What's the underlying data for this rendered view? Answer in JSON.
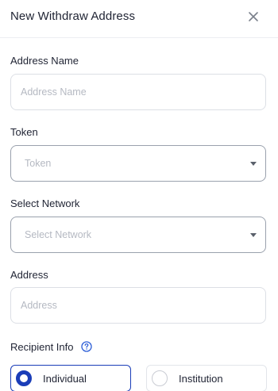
{
  "header": {
    "title": "New Withdraw Address",
    "close_icon": "close-icon"
  },
  "form": {
    "address_name": {
      "label": "Address Name",
      "placeholder": "Address Name",
      "value": ""
    },
    "token": {
      "label": "Token",
      "placeholder": "Token",
      "selected": ""
    },
    "network": {
      "label": "Select Network",
      "placeholder": "Select Network",
      "selected": ""
    },
    "address": {
      "label": "Address",
      "placeholder": "Address",
      "value": ""
    },
    "recipient_info": {
      "label": "Recipient Info",
      "help_icon": "help-circle-icon",
      "options": [
        {
          "label": "Individual",
          "selected": true
        },
        {
          "label": "Institution",
          "selected": false
        }
      ]
    }
  },
  "colors": {
    "accent": "#1a3db8",
    "text": "#1f2333",
    "placeholder": "#b5b9c2",
    "border": "#dcdfe5",
    "help_icon": "#2a5cd6"
  }
}
